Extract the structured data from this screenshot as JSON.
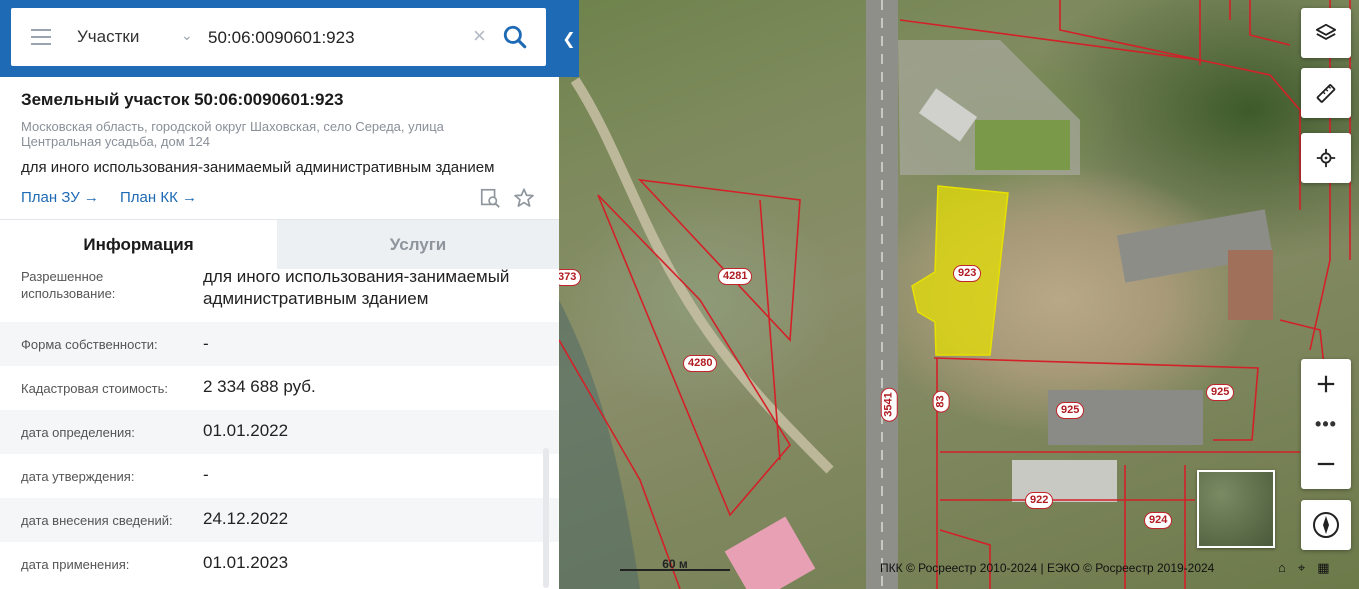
{
  "search": {
    "layer": "Участки",
    "query": "50:06:0090601:923"
  },
  "object": {
    "title": "Земельный участок 50:06:0090601:923",
    "address": "Московская область, городской округ Шаховская, село Середа, улица Центральная усадьба, дом 124",
    "usage": "для иного использования-занимаемый административным зданием",
    "plan_zu": "План ЗУ",
    "plan_kk": "План КК"
  },
  "tabs": {
    "info": "Информация",
    "services": "Услуги"
  },
  "rows": [
    {
      "label": "Разрешенное использование:",
      "value": "для иного использования-занимаемый административным зданием"
    },
    {
      "label": "Форма собственности:",
      "value": "-"
    },
    {
      "label": "Кадастровая стоимость:",
      "value": "2 334 688 руб."
    },
    {
      "label": "дата определения:",
      "value": "01.01.2022"
    },
    {
      "label": "дата утверждения:",
      "value": "-"
    },
    {
      "label": "дата внесения сведений:",
      "value": "24.12.2022"
    },
    {
      "label": "дата применения:",
      "value": "01.01.2023"
    }
  ],
  "map": {
    "labels": {
      "p923": "923",
      "p4281": "4281",
      "p4280": "4280",
      "p373": "373",
      "p3541": "3541",
      "p83": "83",
      "p925a": "925",
      "p925b": "925",
      "p922": "922",
      "p924": "924"
    },
    "scale": "60 м",
    "attribution": "ПКК © Росреестр 2010-2024 | ЕЭКО © Росреестр 2019-2024"
  },
  "colors": {
    "header": "#1e6ab5",
    "link": "#1e6ab5",
    "parcel_border": "#d42028",
    "selected_fill": "#e8e000"
  }
}
